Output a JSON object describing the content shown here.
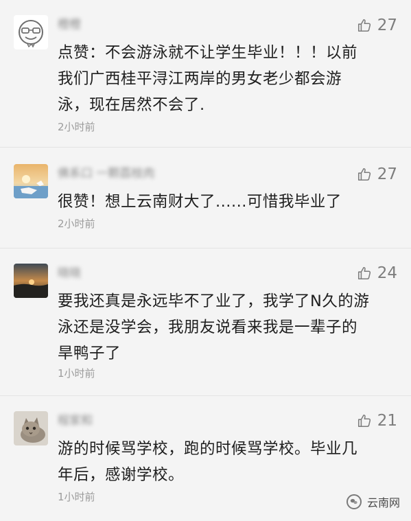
{
  "comments": [
    {
      "user": "橙橙",
      "likes": "27",
      "text_lines": [
        "点赞：不会游泳就不让学生毕业！！！以前",
        "我们广西桂平浔江两岸的男女老少都会游",
        "泳，现在居然不会了."
      ],
      "time": "2小时前",
      "avatar": "emoji-face-avatar"
    },
    {
      "user": "佛系口 一颗荔枝肉",
      "likes": "27",
      "text_lines": [
        "很赞！想上云南财大了......可惜我毕业了"
      ],
      "time": "2小时前",
      "avatar": "sunset-sea-avatar"
    },
    {
      "user": "晓晓",
      "likes": "24",
      "text_lines": [
        "要我还真是永远毕不了业了，我学了N久的游",
        "泳还是没学会，我朋友说看来我是一辈子的",
        "旱鸭子了"
      ],
      "time": "1小时前",
      "avatar": "dusk-landscape-avatar"
    },
    {
      "user": "程家和",
      "likes": "21",
      "text_lines": [
        "游的时候骂学校，跑的时候骂学校。毕业几",
        "年后，感谢学校。"
      ],
      "time": "1小时前",
      "avatar": "kitten-avatar"
    }
  ],
  "watermark": {
    "label": "云南网"
  },
  "colors": {
    "background": "#f4f4f4",
    "text": "#1e1e1e",
    "muted": "#9b9b9b",
    "icon": "#7d7d7d"
  }
}
